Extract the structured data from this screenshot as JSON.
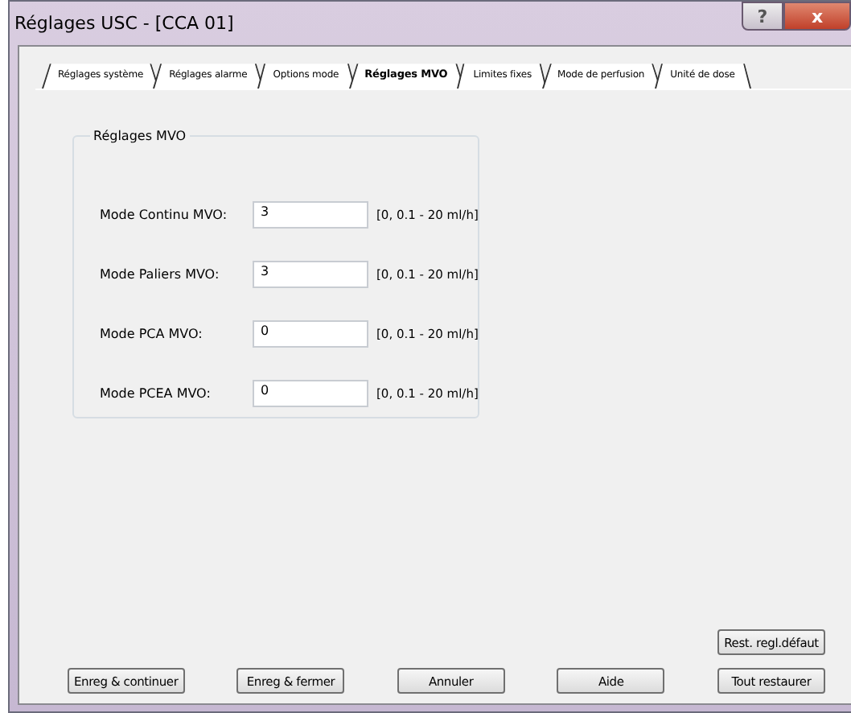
{
  "window": {
    "title": "Réglages USC - [CCA 01]",
    "help": "?",
    "close": "x"
  },
  "tabs": [
    {
      "label": "Réglages système",
      "selected": false
    },
    {
      "label": "Réglages alarme",
      "selected": false
    },
    {
      "label": "Options mode",
      "selected": false
    },
    {
      "label": "Réglages MVO",
      "selected": true
    },
    {
      "label": "Limites fixes",
      "selected": false
    },
    {
      "label": "Mode de perfusion",
      "selected": false
    },
    {
      "label": "Unité de dose",
      "selected": false
    }
  ],
  "group": {
    "title": "Réglages MVO",
    "fields": [
      {
        "label": "Mode Continu MVO:",
        "value": "3",
        "range": "[0, 0.1 - 20 ml/h]"
      },
      {
        "label": "Mode Paliers MVO:",
        "value": "3",
        "range": "[0, 0.1 - 20 ml/h]"
      },
      {
        "label": "Mode PCA MVO:",
        "value": "0",
        "range": "[0, 0.1 - 20 ml/h]"
      },
      {
        "label": "Mode PCEA MVO:",
        "value": "0",
        "range": "[0, 0.1 - 20 ml/h]"
      }
    ]
  },
  "restore_default": "Rest. regl.défaut",
  "buttons": [
    "Enreg & continuer",
    "Enreg & fermer",
    "Annuler",
    "Aide",
    "Tout restaurer"
  ]
}
